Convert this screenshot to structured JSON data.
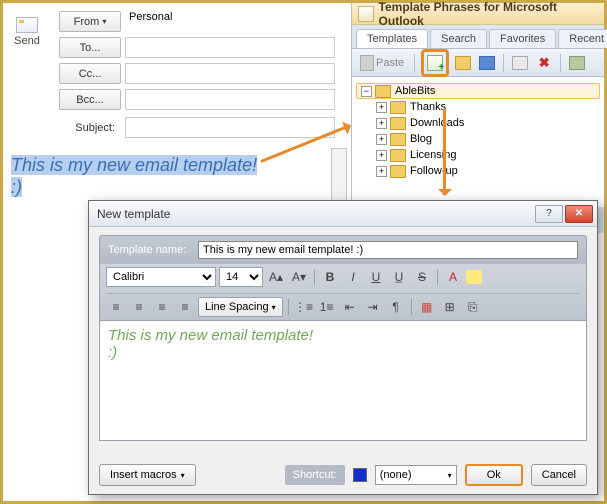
{
  "compose": {
    "send": "Send",
    "from_label": "From",
    "from_value": "Personal",
    "to_label": "To...",
    "cc_label": "Cc...",
    "bcc_label": "Bcc...",
    "subject_label": "Subject:",
    "body_line1": "This is my new email template!",
    "body_line2": ":)"
  },
  "pane": {
    "title": "Template Phrases for Microsoft Outlook",
    "tabs": [
      "Templates",
      "Search",
      "Favorites",
      "Recent"
    ],
    "paste": "Paste",
    "tree_root": "AbleBits",
    "tree_children": [
      "Thanks",
      "Downloads",
      "Blog",
      "Licensing",
      "Follow-up"
    ]
  },
  "dialog": {
    "title": "New template",
    "name_label": "Template name:",
    "name_value": "This is my new email template! :)",
    "font": "Calibri",
    "size": "14",
    "line_spacing": "Line Spacing",
    "content_line1": "This is my new email template!",
    "content_line2": ":)",
    "insert_macros": "Insert macros",
    "shortcut_label": "Shortcut:",
    "shortcut_value": "(none)",
    "ok": "Ok",
    "cancel": "Cancel"
  }
}
